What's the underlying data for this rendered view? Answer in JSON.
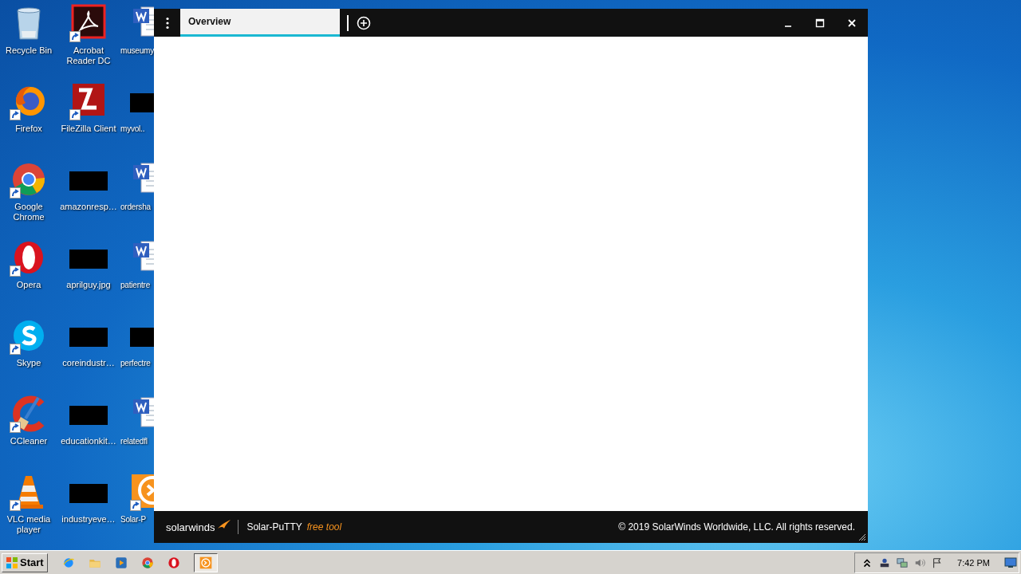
{
  "desktop": {
    "icons": [
      {
        "label": "Recycle Bin",
        "kind": "recycle",
        "shortcut": false
      },
      {
        "label": "Acrobat Reader DC",
        "kind": "acrobat",
        "shortcut": true
      },
      {
        "label": "museumy",
        "kind": "word",
        "shortcut": false
      },
      {
        "label": "Firefox",
        "kind": "firefox",
        "shortcut": true
      },
      {
        "label": "FileZilla Client",
        "kind": "filezilla",
        "shortcut": true
      },
      {
        "label": "myvol..",
        "kind": "thumb",
        "shortcut": false
      },
      {
        "label": "Google Chrome",
        "kind": "chrome",
        "shortcut": true
      },
      {
        "label": "amazonresp…",
        "kind": "thumb",
        "shortcut": false
      },
      {
        "label": "ordersha",
        "kind": "word",
        "shortcut": false
      },
      {
        "label": "Opera",
        "kind": "opera",
        "shortcut": true
      },
      {
        "label": "aprilguy.jpg",
        "kind": "thumb",
        "shortcut": false
      },
      {
        "label": "patientre",
        "kind": "word",
        "shortcut": false
      },
      {
        "label": "Skype",
        "kind": "skype",
        "shortcut": true
      },
      {
        "label": "coreindustr…",
        "kind": "thumb",
        "shortcut": false
      },
      {
        "label": "perfectre",
        "kind": "thumb",
        "shortcut": false
      },
      {
        "label": "CCleaner",
        "kind": "ccleaner",
        "shortcut": true
      },
      {
        "label": "educationkit…",
        "kind": "thumb",
        "shortcut": false
      },
      {
        "label": "relatedfl",
        "kind": "word",
        "shortcut": false
      },
      {
        "label": "VLC media player",
        "kind": "vlc",
        "shortcut": true
      },
      {
        "label": "industryeve…",
        "kind": "thumb",
        "shortcut": false
      },
      {
        "label": "Solar-P",
        "kind": "putty",
        "shortcut": true
      }
    ]
  },
  "window": {
    "tabs": [
      {
        "label": "Overview",
        "selected": true
      }
    ],
    "footer": {
      "brand": "solarwinds",
      "product": "Solar-PuTTY",
      "edition": "free tool",
      "copyright": "© 2019 SolarWinds Worldwide, LLC. All rights reserved."
    }
  },
  "taskbar": {
    "start": "Start",
    "quick_launch": [
      {
        "kind": "ie"
      },
      {
        "kind": "explorer"
      },
      {
        "kind": "media"
      },
      {
        "kind": "chrome"
      },
      {
        "kind": "opera"
      }
    ],
    "tasks": [
      {
        "kind": "putty",
        "selected": true
      }
    ],
    "clock": "7:42 PM"
  }
}
